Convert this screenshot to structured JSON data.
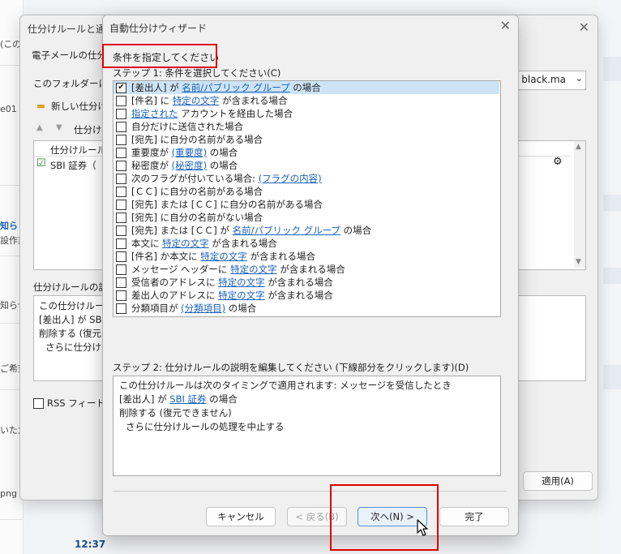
{
  "background": {
    "left_texts": [
      "(この",
      "e01",
      "知ら",
      "設作業",
      "知らせ",
      "ご希望",
      "いただ",
      "png",
      "12:37"
    ],
    "rules_dialog": {
      "title": "仕分けルールと通知",
      "email_rules_tab": "電子メールの仕分",
      "folder_label": "このフォルダーに変",
      "account_value": "p, black.ma",
      "new_rule": "新しい仕分け",
      "rule_column": "仕分けルール",
      "rule_up_down": "仕分け",
      "rule_item": "SBI 証券（",
      "desc_label": "仕分けルールの説",
      "desc_lines": [
        "この仕分けルール",
        "[差出人] が SBI",
        "削除する (復元",
        "さらに仕分けル"
      ],
      "rss_label": "RSS フィードか",
      "apply_button": "適用(A)"
    }
  },
  "wizard": {
    "title": "自動仕分けウィザード",
    "header": "条件を指定してください",
    "step1_label": "ステップ 1: 条件を選択してください(C)",
    "conditions": [
      {
        "checked": true,
        "parts": [
          {
            "t": "[差出人] が "
          },
          {
            "t": "名前/パブリック グループ",
            "link": true
          },
          {
            "t": " の場合"
          }
        ]
      },
      {
        "checked": false,
        "parts": [
          {
            "t": "[件名] に "
          },
          {
            "t": "特定の文字",
            "link": true
          },
          {
            "t": " が含まれる場合"
          }
        ]
      },
      {
        "checked": false,
        "parts": [
          {
            "t": "指定された",
            "link": true
          },
          {
            "t": " アカウントを経由した場合"
          }
        ]
      },
      {
        "checked": false,
        "parts": [
          {
            "t": "自分だけに送信された場合"
          }
        ]
      },
      {
        "checked": false,
        "parts": [
          {
            "t": "[宛先] に自分の名前がある場合"
          }
        ]
      },
      {
        "checked": false,
        "parts": [
          {
            "t": "重要度が "
          },
          {
            "t": "(重要度)",
            "link": true
          },
          {
            "t": " の場合"
          }
        ]
      },
      {
        "checked": false,
        "parts": [
          {
            "t": "秘密度が "
          },
          {
            "t": "(秘密度)",
            "link": true
          },
          {
            "t": " の場合"
          }
        ]
      },
      {
        "checked": false,
        "parts": [
          {
            "t": "次のフラグが付いている場合: "
          },
          {
            "t": "(フラグの内容)",
            "link": true
          }
        ]
      },
      {
        "checked": false,
        "parts": [
          {
            "t": "[ＣＣ] に自分の名前がある場合"
          }
        ]
      },
      {
        "checked": false,
        "parts": [
          {
            "t": "[宛先] または [ＣＣ] に自分の名前がある場合"
          }
        ]
      },
      {
        "checked": false,
        "parts": [
          {
            "t": "[宛先] に自分の名前がない場合"
          }
        ]
      },
      {
        "checked": false,
        "parts": [
          {
            "t": "[宛先] または [ＣＣ] が "
          },
          {
            "t": "名前/パブリック グループ",
            "link": true
          },
          {
            "t": " の場合"
          }
        ]
      },
      {
        "checked": false,
        "parts": [
          {
            "t": "本文に "
          },
          {
            "t": "特定の文字",
            "link": true
          },
          {
            "t": " が含まれる場合"
          }
        ]
      },
      {
        "checked": false,
        "parts": [
          {
            "t": "[件名] か本文に "
          },
          {
            "t": "特定の文字",
            "link": true
          },
          {
            "t": " が含まれる場合"
          }
        ]
      },
      {
        "checked": false,
        "parts": [
          {
            "t": "メッセージ ヘッダーに "
          },
          {
            "t": "特定の文字",
            "link": true
          },
          {
            "t": " が含まれる場合"
          }
        ]
      },
      {
        "checked": false,
        "parts": [
          {
            "t": "受信者のアドレスに "
          },
          {
            "t": "特定の文字",
            "link": true
          },
          {
            "t": " が含まれる場合"
          }
        ]
      },
      {
        "checked": false,
        "parts": [
          {
            "t": "差出人のアドレスに "
          },
          {
            "t": "特定の文字",
            "link": true
          },
          {
            "t": " が含まれる場合"
          }
        ]
      },
      {
        "checked": false,
        "parts": [
          {
            "t": "分類項目が "
          },
          {
            "t": "(分類項目)",
            "link": true
          },
          {
            "t": " の場合"
          }
        ]
      }
    ],
    "step2_label": "ステップ 2: 仕分けルールの説明を編集してください (下線部分をクリックします)(D)",
    "description": {
      "line1": "この仕分けルールは次のタイミングで適用されます: メッセージを受信したとき",
      "line2_pre": "[差出人] が ",
      "line2_link": "SBI 証券",
      "line2_post": " の場合",
      "line3": "削除する (復元できません)",
      "line4": "さらに仕分けルールの処理を中止する"
    },
    "buttons": {
      "cancel": "キャンセル",
      "back": "< 戻る(B)",
      "next": "次へ(N) >",
      "finish": "完了"
    }
  },
  "colors": {
    "link": "#1a62b8",
    "highlight": "#e00000",
    "selected_row": "#cde4f7"
  }
}
